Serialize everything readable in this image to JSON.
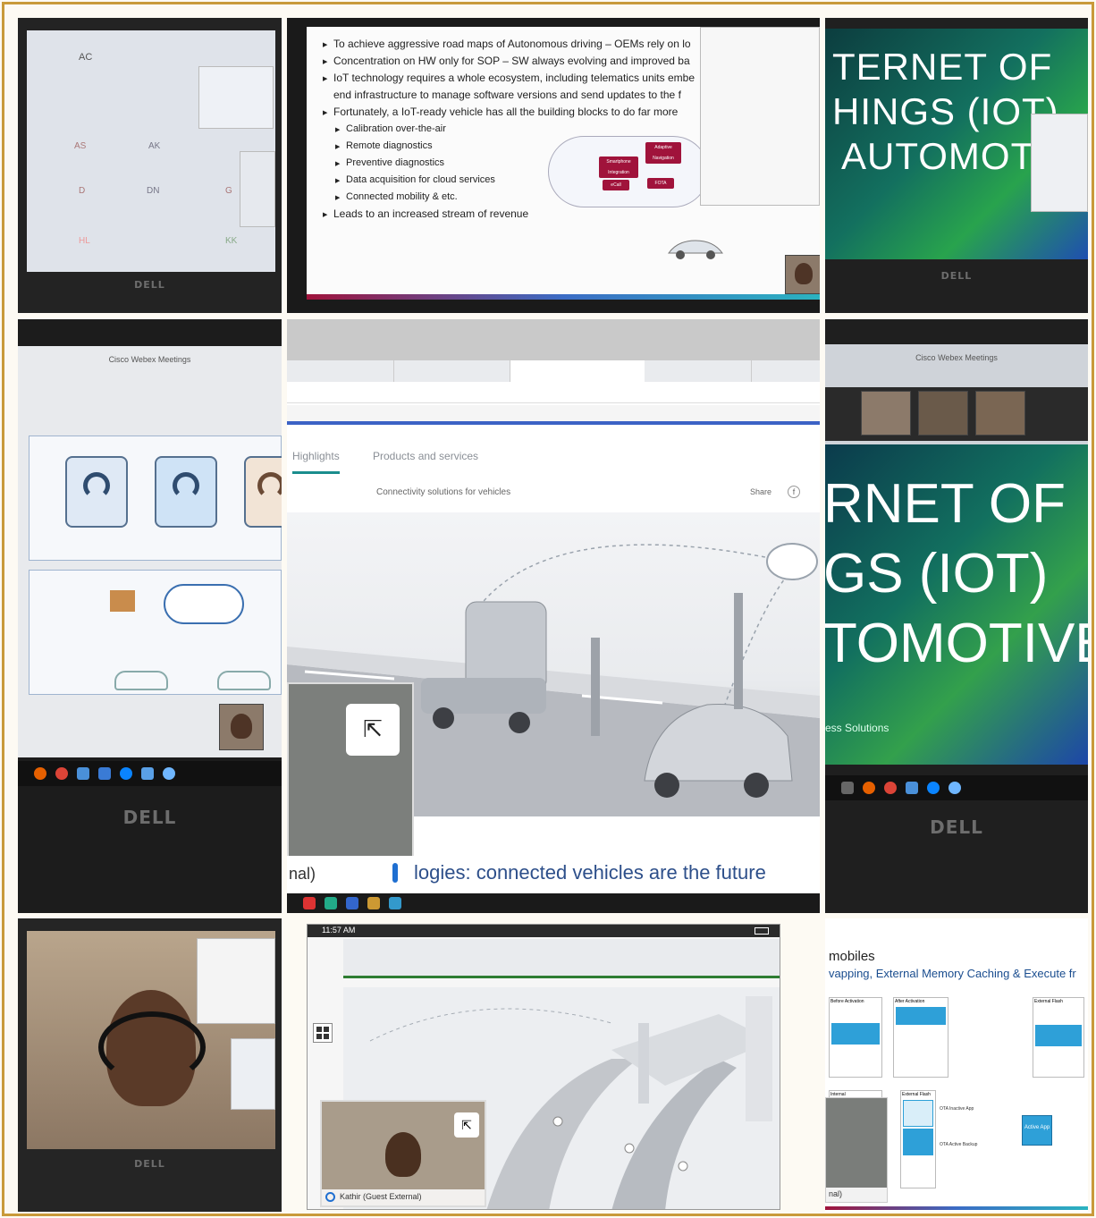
{
  "tile1": {
    "names": [
      "AC",
      "AS",
      "AK",
      "D",
      "DN",
      "G",
      "HL",
      "KK"
    ],
    "logo": "DELL"
  },
  "tile2": {
    "bullets": [
      "To achieve aggressive road maps of Autonomous driving – OEMs rely on lo",
      "Concentration on HW only for SOP – SW always evolving and improved ba",
      "IoT technology requires a whole ecosystem, including telematics units embe",
      "end infrastructure to manage software versions and send updates to the f",
      "Fortunately, a IoT-ready vehicle has all the building blocks to do far more"
    ],
    "sub_bullets": [
      "Calibration over-the-air",
      "Remote diagnostics",
      "Preventive diagnostics",
      "Data acquisition for cloud services",
      "Connected mobility & etc."
    ],
    "last_bullet": "Leads to an increased stream of revenue",
    "diagram_chips": [
      "Adaptive Navigation",
      "Smartphone Integration",
      "eCall",
      "FOTA"
    ]
  },
  "tile3": {
    "lines": [
      "TERNET OF",
      "HINGS (IOT)",
      "AUTOMOT"
    ],
    "logo": "DELL"
  },
  "tile4": {
    "title": "Cisco Webex Meetings",
    "logo": "DELL"
  },
  "tile5": {
    "tab_main": "Highlights",
    "tab_products": "Products and services",
    "breadcrumb": "Connectivity solutions for vehicles",
    "share_label": "Share",
    "caption": "logies: connected vehicles are the future",
    "self_view_label": "nal)"
  },
  "tile6": {
    "title": "Cisco Webex Meetings",
    "lines": [
      "RNET OF",
      "GS (IOT)",
      "TOMOTIVE"
    ],
    "footer": "ess Solutions",
    "logo": "DELL"
  },
  "tile7": {
    "logo": "DELL"
  },
  "tile8": {
    "time": "11:57 AM",
    "participant": "Kathir (Guest External)"
  },
  "tile9": {
    "heading": "mobiles",
    "subheading": "vapping, External Memory Caching & Execute fr",
    "self_view_label": "nal)",
    "boxes": [
      "Before Activation",
      "After Activation",
      "External Flash",
      "Internal",
      "External Flash",
      "Active App",
      "OTA Inactive App",
      "OTA Active Backup"
    ]
  },
  "colors": {
    "frame": "#c99a3a",
    "brand_red": "#a0133b",
    "webex_blue": "#1f6fd1"
  }
}
